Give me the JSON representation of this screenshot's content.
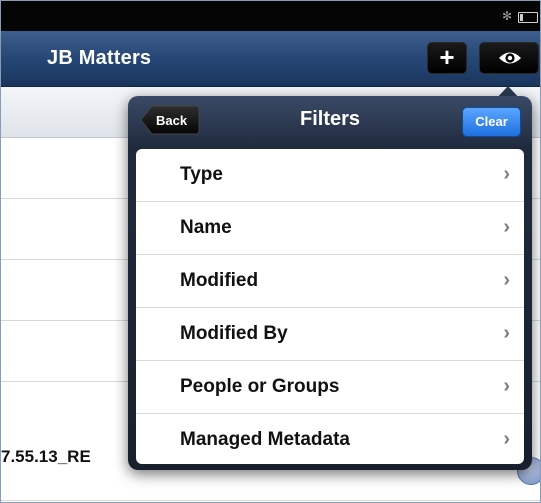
{
  "statusbar": {
    "bluetooth_icon": "bluetooth-icon",
    "battery_icon": "battery-icon"
  },
  "navbar": {
    "title": "JB Matters",
    "add_label": "+",
    "view_icon": "eye-icon"
  },
  "background_list": {
    "partial_item_text": "7.55.13_RE"
  },
  "filters_popover": {
    "back_label": "Back",
    "title": "Filters",
    "clear_label": "Clear",
    "items": [
      {
        "label": "Type"
      },
      {
        "label": "Name"
      },
      {
        "label": "Modified"
      },
      {
        "label": "Modified By"
      },
      {
        "label": "People or Groups"
      },
      {
        "label": "Managed Metadata"
      }
    ]
  },
  "colors": {
    "navbar": "#244574",
    "clear_button": "#1f6fe0",
    "popover": "#1f2a3d"
  }
}
